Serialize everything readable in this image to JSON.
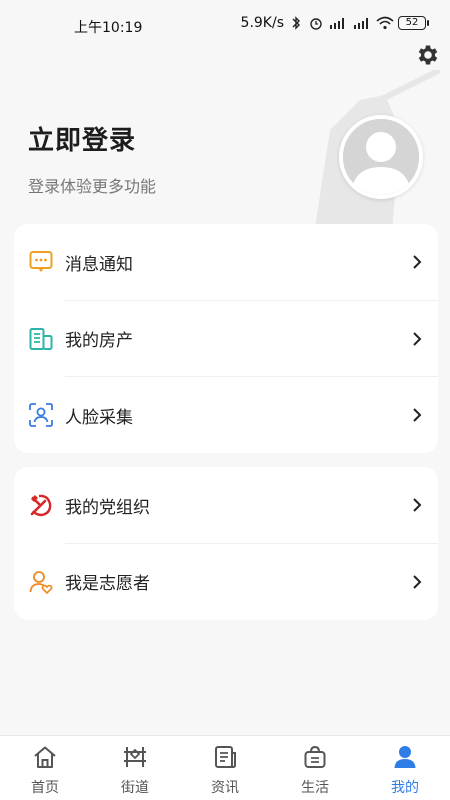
{
  "status_bar": {
    "time": "上午10:19",
    "network_speed": "5.9K/s",
    "battery": "52"
  },
  "header": {
    "login_title": "立即登录",
    "login_subtitle": "登录体验更多功能"
  },
  "menu_group_1": [
    {
      "label": "消息通知",
      "icon": "message-icon",
      "color": "#f0a020"
    },
    {
      "label": "我的房产",
      "icon": "property-icon",
      "color": "#2bb5a8"
    },
    {
      "label": "人脸采集",
      "icon": "face-scan-icon",
      "color": "#3a7be0"
    }
  ],
  "menu_group_2": [
    {
      "label": "我的党组织",
      "icon": "party-icon",
      "color": "#d8282a"
    },
    {
      "label": "我是志愿者",
      "icon": "volunteer-icon",
      "color": "#f08a20"
    }
  ],
  "tabbar": {
    "active_color": "#2f7ee8",
    "tabs": [
      {
        "label": "首页",
        "icon": "home-icon"
      },
      {
        "label": "街道",
        "icon": "street-icon"
      },
      {
        "label": "资讯",
        "icon": "news-icon"
      },
      {
        "label": "生活",
        "icon": "life-icon"
      },
      {
        "label": "我的",
        "icon": "profile-icon",
        "active": true
      }
    ]
  }
}
